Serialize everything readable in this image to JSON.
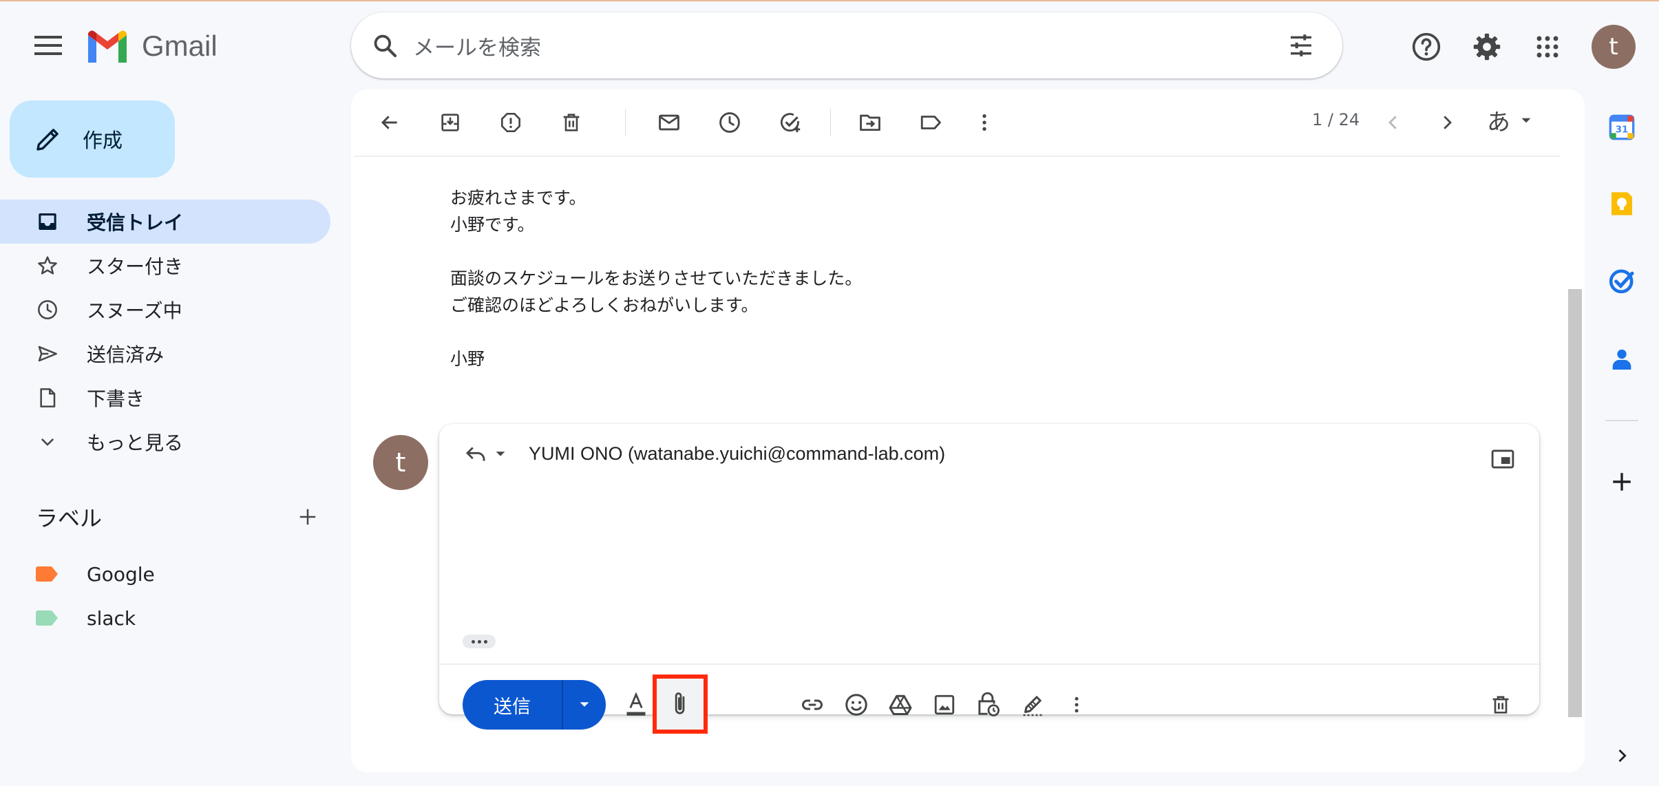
{
  "app": {
    "name": "Gmail"
  },
  "search": {
    "placeholder": "メールを検索"
  },
  "compose": {
    "label": "作成"
  },
  "nav": {
    "items": [
      {
        "label": "受信トレイ"
      },
      {
        "label": "スター付き"
      },
      {
        "label": "スヌーズ中"
      },
      {
        "label": "送信済み"
      },
      {
        "label": "下書き"
      },
      {
        "label": "もっと見る"
      }
    ]
  },
  "labels": {
    "title": "ラベル",
    "items": [
      {
        "label": "Google",
        "color": "#fe7b35"
      },
      {
        "label": "slack",
        "color": "#98dbb6"
      }
    ]
  },
  "toolbar": {
    "pager": "1 / 24",
    "input_mode": "あ"
  },
  "message": {
    "lines": [
      "お疲れさまです。",
      "小野です。",
      "",
      "面談のスケジュールをお送りさせていただきました。",
      "ご確認のほどよろしくおねがいします。",
      "",
      "小野"
    ]
  },
  "reply": {
    "avatar_initial": "t",
    "recipient": "YUMI ONO (watanabe.yuichi@command-lab.com)",
    "send_label": "送信"
  },
  "user": {
    "avatar_initial": "t"
  },
  "colors": {
    "accent": "#0b57d0",
    "active_nav": "#d3e3fd",
    "compose_bg": "#c2e7ff",
    "highlight": "#ff2a0d"
  }
}
